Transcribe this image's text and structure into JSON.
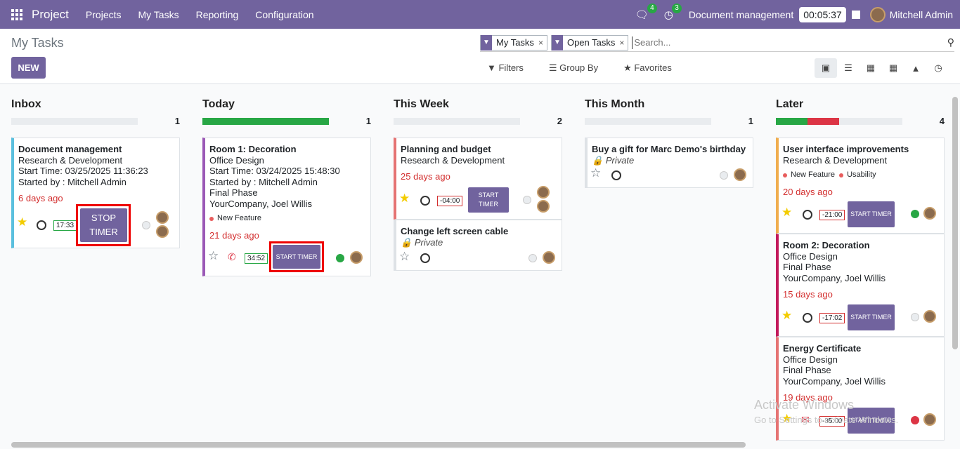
{
  "topbar": {
    "app_name": "Project",
    "menus": [
      "Projects",
      "My Tasks",
      "Reporting",
      "Configuration"
    ],
    "chat_badge": "4",
    "activity_badge": "3",
    "running_task": "Document management",
    "timer": "00:05:37",
    "user": "Mitchell Admin"
  },
  "control_panel": {
    "breadcrumb": "My Tasks",
    "new_label": "NEW",
    "facets": [
      "My Tasks",
      "Open Tasks"
    ],
    "search_placeholder": "Search...",
    "filters_label": "Filters",
    "groupby_label": "Group By",
    "favorites_label": "Favorites",
    "views": [
      "kanban",
      "list",
      "calendar",
      "pivot",
      "graph",
      "activity"
    ]
  },
  "columns": [
    {
      "title": "Inbox",
      "count": "1"
    },
    {
      "title": "Today",
      "count": "1"
    },
    {
      "title": "This Week",
      "count": "2"
    },
    {
      "title": "This Month",
      "count": "1"
    },
    {
      "title": "Later",
      "count": "4"
    }
  ],
  "cards": {
    "c1": {
      "title": "Document management",
      "project": "Research & Development",
      "start": "Start Time: 03/25/2025 11:36:23",
      "started_by": "Started by : Mitchell Admin",
      "ago": "6 days ago",
      "timer": "17:33",
      "button": "STOP TIMER"
    },
    "c2": {
      "title": "Room 1: Decoration",
      "project": "Office Design",
      "start": "Start Time: 03/24/2025 15:48:30",
      "started_by": "Started by : Mitchell Admin",
      "phase": "Final Phase",
      "customer": "YourCompany, Joel Willis",
      "tag": "New Feature",
      "ago": "21 days ago",
      "timer": "34:52",
      "button": "START TIMER"
    },
    "c3": {
      "title": "Planning and budget",
      "project": "Research & Development",
      "ago": "25 days ago",
      "deadline": "-04:00",
      "button": "START TIMER"
    },
    "c4": {
      "title": "Change left screen cable",
      "private": "Private"
    },
    "c5": {
      "title": "Buy a gift for Marc Demo's birthday",
      "private": "Private"
    },
    "c6": {
      "title": "User interface improvements",
      "project": "Research & Development",
      "tag1": "New Feature",
      "tag2": "Usability",
      "ago": "20 days ago",
      "deadline": "-21:00",
      "button": "START TIMER"
    },
    "c7": {
      "title": "Room 2: Decoration",
      "project": "Office Design",
      "phase": "Final Phase",
      "customer": "YourCompany, Joel Willis",
      "ago": "15 days ago",
      "deadline": "-17:02",
      "button": "START TIMER"
    },
    "c8": {
      "title": "Energy Certificate",
      "project": "Office Design",
      "phase": "Final Phase",
      "customer": "YourCompany, Joel Willis",
      "ago": "19 days ago",
      "deadline": "-35:00",
      "button": "START TIMER"
    }
  },
  "watermark": {
    "line1": "Activate Windows",
    "line2": "Go to Settings to activate Windows."
  },
  "colors": {
    "brand": "#71639e",
    "overdue": "#d32f2f",
    "done": "#28a745",
    "blocked": "#dc3545",
    "star": "#f3cc00"
  }
}
